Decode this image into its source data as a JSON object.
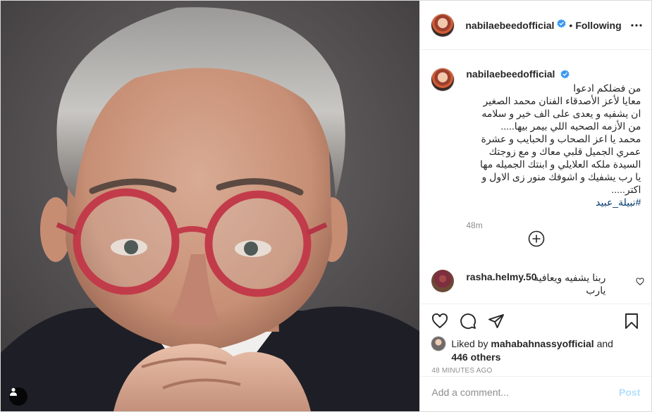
{
  "post": {
    "author": "nabilaebeedofficial",
    "following_label": "Following",
    "dot": "•",
    "caption_lines": "من فضلكم ادعوا\nمعايا لأعز الأصدقاء الفنان محمد الصغير\nان يشفيه و يعدى على الف خير و سلامه\nمن الأزمه الصحيه اللي بيمر بيها.....\nمحمد يا اعز الصحاب و الحبايب و عشرة\nعمري الجميل قلبي معاك و مع زوجتك\nالسيدة ملكه العلايلي و ابنتك الجميله مها\nيا رب يشفيك و اشوفك منور زى الاول و\nاكتر.....",
    "hashtag": "#نبيلة_عبيد",
    "caption_time": "48m",
    "comment": {
      "user": "rasha.helmy.50",
      "text": "ربنا يشفيه ويعافيه\nيارب"
    },
    "likes": {
      "prefix": "Liked by",
      "user": "mahabahnassyofficial",
      "middle": "and",
      "count": "446 others"
    },
    "timestamp": "48 MINUTES AGO",
    "add_comment_placeholder": "Add a comment...",
    "post_button": "Post"
  },
  "icons": {
    "verified": "verified-badge-icon",
    "more": "more-options-icon",
    "add": "load-more-comments-icon",
    "heart": "heart-icon",
    "comment": "comment-icon",
    "share": "share-icon",
    "save": "save-icon",
    "user_tag": "user-tag-icon"
  },
  "colors": {
    "verified_blue": "#3897f0",
    "link": "#00376b",
    "muted": "#8e8e8e",
    "post_disabled": "#b2dffc"
  }
}
